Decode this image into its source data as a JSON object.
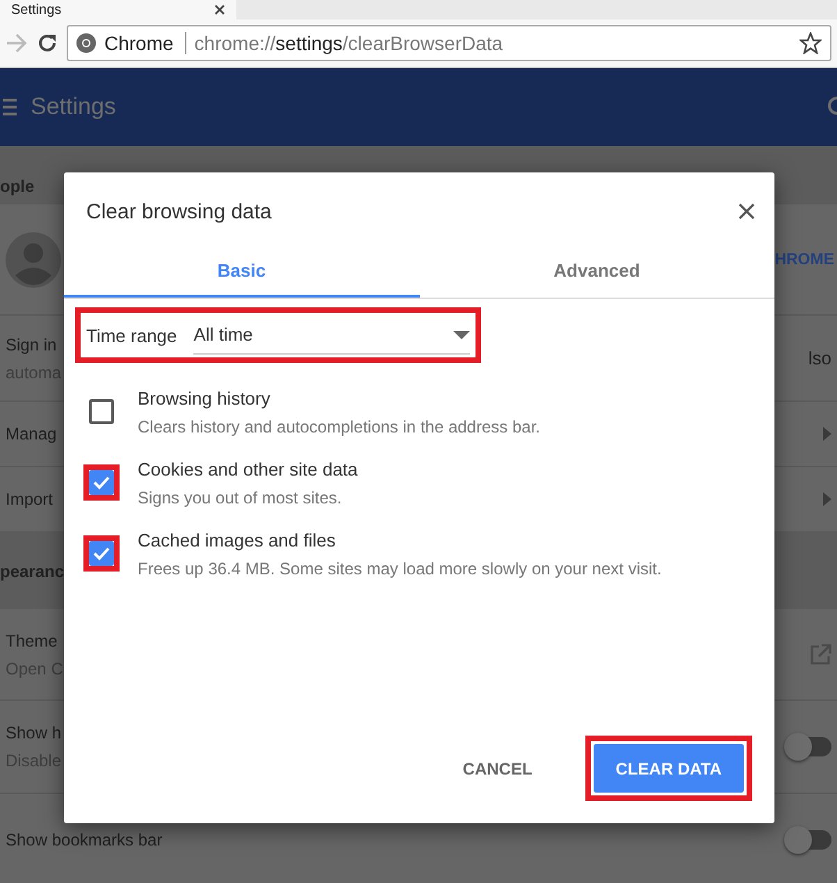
{
  "browser": {
    "tab": {
      "title": "Settings"
    },
    "omnibox": {
      "site": "Chrome",
      "url": {
        "scheme": "chrome://",
        "host": "settings",
        "path": "/clearBrowserData"
      }
    }
  },
  "header": {
    "title": "Settings"
  },
  "settings": {
    "sections": [
      {
        "title": "ople",
        "rows": [
          {
            "kind": "avatar",
            "right": "HROME"
          },
          {
            "kind": "text",
            "lines": [
              "Sign in",
              "automa"
            ],
            "right": "lso"
          },
          {
            "kind": "arrow",
            "lines": [
              "Manag"
            ]
          },
          {
            "kind": "arrow",
            "lines": [
              "Import"
            ]
          }
        ]
      },
      {
        "title": "pearanc",
        "rows": [
          {
            "kind": "external",
            "lines": [
              "Theme",
              "Open C"
            ]
          },
          {
            "kind": "toggle",
            "lines": [
              "Show h",
              "Disable"
            ],
            "on": false
          },
          {
            "kind": "toggle",
            "lines": [
              "Show bookmarks bar"
            ],
            "on": false
          }
        ]
      }
    ]
  },
  "dialog": {
    "title": "Clear browsing data",
    "tabs": [
      {
        "label": "Basic",
        "selected": true
      },
      {
        "label": "Advanced",
        "selected": false
      }
    ],
    "time_range": {
      "label": "Time range",
      "value": "All time",
      "highlighted": true
    },
    "items": [
      {
        "title": "Browsing history",
        "description": "Clears history and autocompletions in the address bar.",
        "checked": false,
        "highlighted": false
      },
      {
        "title": "Cookies and other site data",
        "description": "Signs you out of most sites.",
        "checked": true,
        "highlighted": true
      },
      {
        "title": "Cached images and files",
        "description": "Frees up 36.4 MB. Some sites may load more slowly on your next visit.",
        "checked": true,
        "highlighted": true
      }
    ],
    "buttons": [
      {
        "label": "CANCEL",
        "kind": "text",
        "highlighted": false
      },
      {
        "label": "CLEAR DATA",
        "kind": "primary",
        "highlighted": true
      }
    ]
  }
}
